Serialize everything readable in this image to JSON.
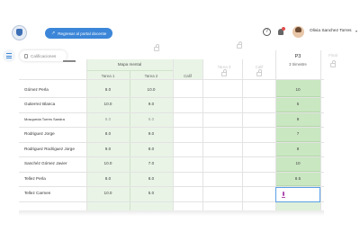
{
  "header": {
    "portal_button": "Regresar al portal docente",
    "user_name": "Olivia Sanchez Torres"
  },
  "toolbar": {
    "tab_label": "Calificaciones"
  },
  "columns": {
    "group_label": "Mapa mental",
    "sub1": "Tarea 1",
    "sub2": "Tarea 2",
    "calif": "Calif",
    "ghost1": "Tarea 3",
    "ghost2": "Calif",
    "period_title": "P3",
    "period_sub": "3 trimestre",
    "ghost3": "Final"
  },
  "rows": [
    {
      "name": "Gómez Perla",
      "t1": "8.0",
      "t2": "10.0",
      "p3": "10"
    },
    {
      "name": "Gutierrez Blanca",
      "t1": "10.0",
      "t2": "9.0",
      "p3": "5"
    },
    {
      "name": "Mosqueda Torres Sandra",
      "t1": "6.0",
      "t2": "6.0",
      "p3": "9"
    },
    {
      "name": "Rodriguez Jorge",
      "t1": "8.0",
      "t2": "9.0",
      "p3": "7"
    },
    {
      "name": "Rodriguez Rodriguez Jorge",
      "t1": "9.0",
      "t2": "8.0",
      "p3": "8"
    },
    {
      "name": "Sanchéz Gómez Javier",
      "t1": "10.0",
      "t2": "7.0",
      "p3": "10"
    },
    {
      "name": "Tellez Perla",
      "t1": "8.0",
      "t2": "8.0",
      "p3": "8.5"
    },
    {
      "name": "Tellez Carmen",
      "t1": "10.0",
      "t2": "5.0",
      "p3": ""
    }
  ]
}
